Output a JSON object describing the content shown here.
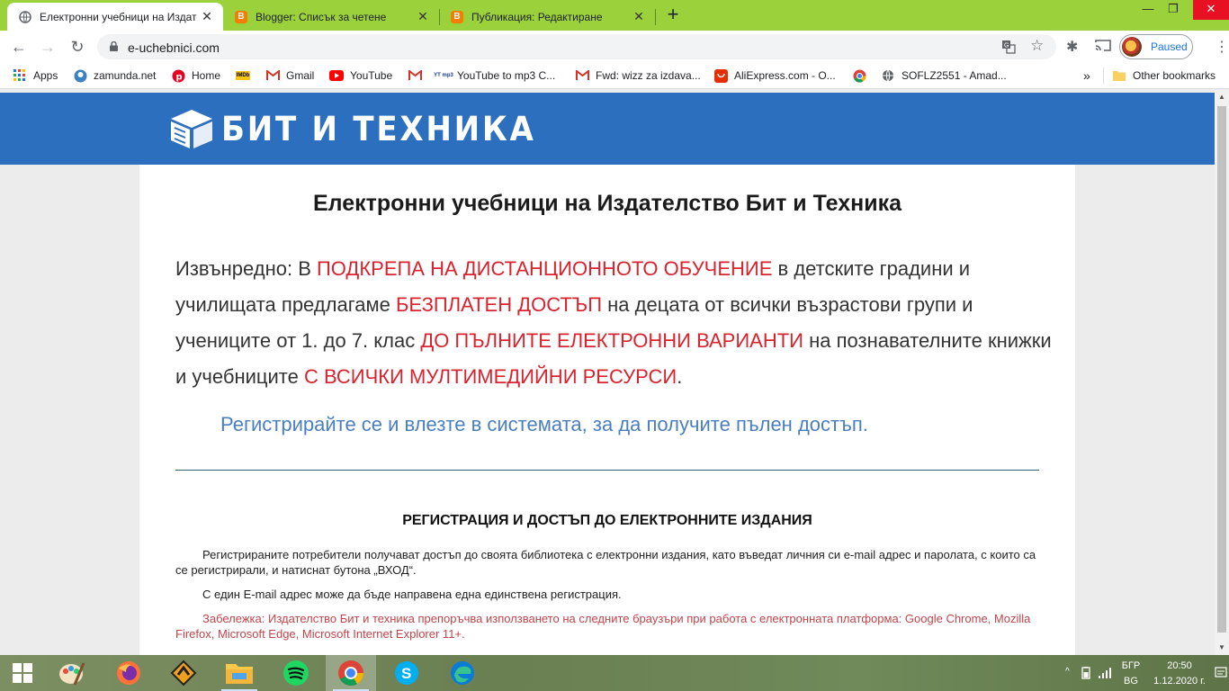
{
  "browser": {
    "tabs": [
      {
        "title": "Електронни учебници на Издат",
        "active": true,
        "favicon": "globe-icon"
      },
      {
        "title": "Blogger: Списък за четене",
        "active": false,
        "favicon": "blogger-icon"
      },
      {
        "title": "Публикация: Редактиране",
        "active": false,
        "favicon": "blogger-icon"
      }
    ],
    "blogger_letter": "B",
    "url": "e-uchebnici.com",
    "profile_button": "Paused",
    "bookmarks": [
      {
        "label": "Apps",
        "icon": "apps-grid-icon"
      },
      {
        "label": "zamunda.net",
        "icon": "zamunda-icon"
      },
      {
        "label": "Home",
        "icon": "pinterest-icon"
      },
      {
        "label": "",
        "icon": "imdb-icon",
        "icon_text": "IMDb"
      },
      {
        "label": "Gmail",
        "icon": "gmail-icon"
      },
      {
        "label": "YouTube",
        "icon": "youtube-icon"
      },
      {
        "label": "",
        "icon": "gmail-icon"
      },
      {
        "label": "YouTube to mp3 C...",
        "icon": "yt-mp3-icon",
        "icon_text": "YT mp3"
      },
      {
        "label": "Fwd: wizz za izdava...",
        "icon": "gmail-icon"
      },
      {
        "label": "AliExpress.com - O...",
        "icon": "aliexpress-icon"
      },
      {
        "label": "",
        "icon": "chrome-icon"
      },
      {
        "label": "SOFLZ2551 - Amad...",
        "icon": "globe-icon"
      }
    ],
    "bookmarks_overflow": "»",
    "other_bookmarks": "Other bookmarks"
  },
  "site": {
    "logo_text": "БИТ И ТЕХНИКА",
    "title": "Електронни учебници на Издателство Бит и Техника",
    "intro": [
      {
        "text": "Извънредно: В ",
        "red": false
      },
      {
        "text": "ПОДКРЕПА НА ДИСТАНЦИОННОТО ОБУЧЕНИЕ",
        "red": true
      },
      {
        "text": " в детските градини и училищата предлагаме ",
        "red": false
      },
      {
        "text": "БЕЗПЛАТЕН ДОСТЪП",
        "red": true
      },
      {
        "text": " на децата от всички възрастови групи и учениците от 1. до 7. клас ",
        "red": false
      },
      {
        "text": "ДО ПЪЛНИТЕ ЕЛЕКТРОННИ ВАРИАНТИ",
        "red": true
      },
      {
        "text": " на познавателните книжки и учебниците ",
        "red": false
      },
      {
        "text": "С ВСИЧКИ МУЛТИМЕДИЙНИ РЕСУРСИ",
        "red": true
      },
      {
        "text": ".",
        "red": false
      }
    ],
    "register_line": "Регистрирайте се и влезте в системата, за да получите пълен достъп.",
    "section_title": "РЕГИСТРАЦИЯ И ДОСТЪП ДО ЕЛЕКТРОННИТЕ ИЗДАНИЯ",
    "paragraph_1": "Регистрираните потребители получават достъп до своята библиотека с електронни издания, като въведат личния си e-mail адрес и паролата, с които са се регистрирали, и натиснат бутона „ВХОД“.",
    "paragraph_2": "С един E-mail адрес може да бъде направена една единствена регистрация.",
    "note": "Забележка: Издателство Бит и техника препоръчва използването на следните браузъри при работа с електронната платформа: Google Chrome, Mozilla Firefox, Microsoft Edge, Microsoft Internet Explorer 11+."
  },
  "taskbar": {
    "apps": [
      "start-icon",
      "paint-icon",
      "firefox-icon",
      "winamp-icon",
      "file-explorer-icon",
      "spotify-icon",
      "chrome-icon",
      "skype-icon",
      "edge-icon"
    ],
    "skype_letter": "S",
    "language_top": "БГР",
    "language_bottom": "BG",
    "time": "20:50",
    "date": "1.12.2020 г."
  },
  "colors": {
    "tab_strip": "#9bd23c",
    "site_header": "#2d6fbf",
    "highlight_red": "#d9232e",
    "register_blue": "#4a7fbf"
  }
}
